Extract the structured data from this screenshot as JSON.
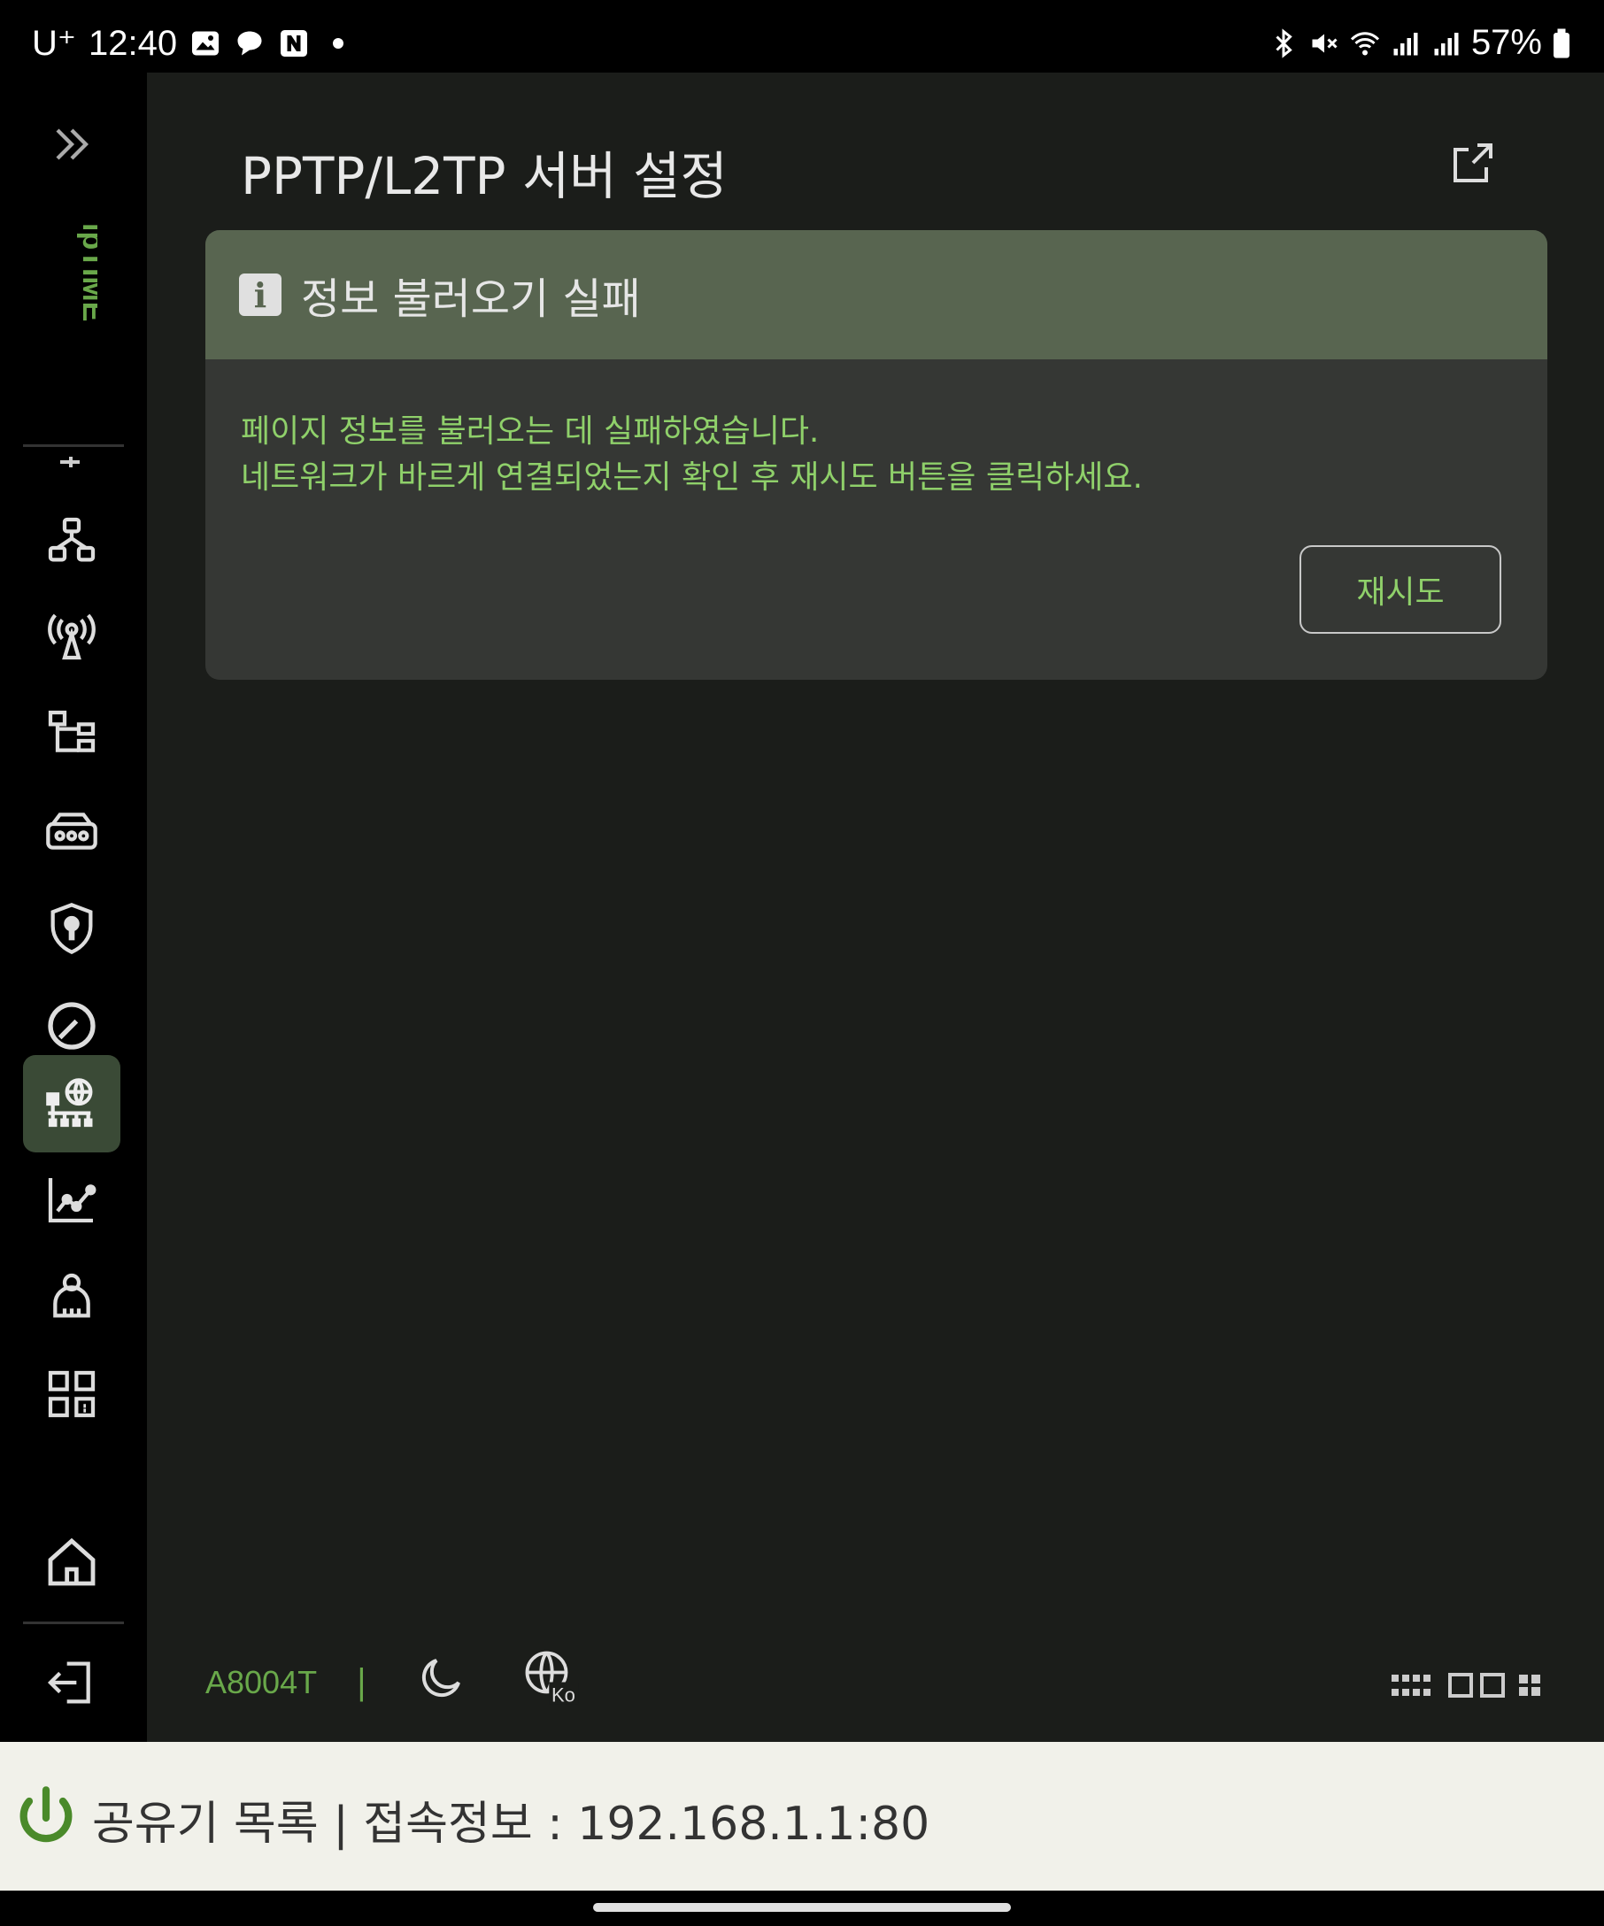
{
  "status_bar": {
    "carrier": "U⁺",
    "time": "12:40",
    "battery": "57%"
  },
  "page": {
    "title": "PPTP/L2TP 서버 설정"
  },
  "error_card": {
    "title": "정보 불러오기 실패",
    "line1": "페이지 정보를 불러오는 데 실패하였습니다.",
    "line2": "네트워크가 바르게 연결되었는지 확인 후 재시도 버튼을 클릭하세요.",
    "retry_label": "재시도"
  },
  "footer": {
    "model": "A8004T",
    "separator": "|"
  },
  "bottom_bar": {
    "text": "공유기 목록  | 접속정보 : 192.168.1.1:80"
  },
  "colors": {
    "accent_green": "#69a84a",
    "card_header": "#586550",
    "active_nav": "#3a4a36"
  },
  "sidebar": {
    "active_item": "advanced-network-icon"
  }
}
